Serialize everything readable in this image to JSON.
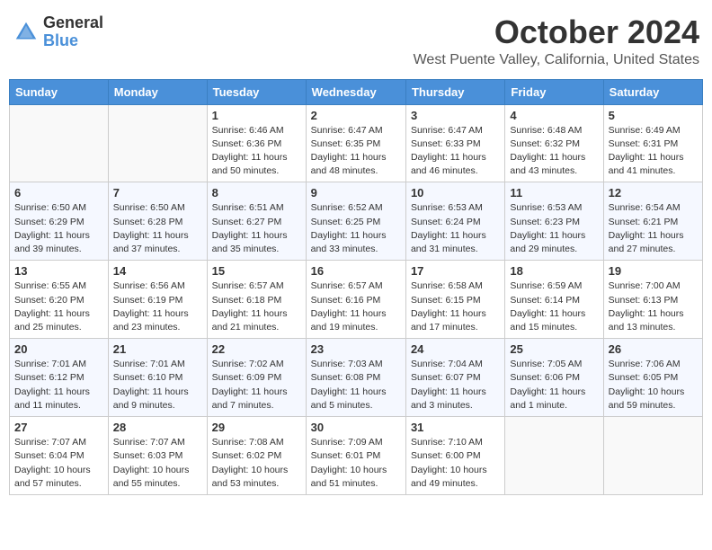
{
  "header": {
    "logo_general": "General",
    "logo_blue": "Blue",
    "month_title": "October 2024",
    "subtitle": "West Puente Valley, California, United States"
  },
  "days_of_week": [
    "Sunday",
    "Monday",
    "Tuesday",
    "Wednesday",
    "Thursday",
    "Friday",
    "Saturday"
  ],
  "weeks": [
    [
      {
        "day": "",
        "info": ""
      },
      {
        "day": "",
        "info": ""
      },
      {
        "day": "1",
        "info": "Sunrise: 6:46 AM\nSunset: 6:36 PM\nDaylight: 11 hours and 50 minutes."
      },
      {
        "day": "2",
        "info": "Sunrise: 6:47 AM\nSunset: 6:35 PM\nDaylight: 11 hours and 48 minutes."
      },
      {
        "day": "3",
        "info": "Sunrise: 6:47 AM\nSunset: 6:33 PM\nDaylight: 11 hours and 46 minutes."
      },
      {
        "day": "4",
        "info": "Sunrise: 6:48 AM\nSunset: 6:32 PM\nDaylight: 11 hours and 43 minutes."
      },
      {
        "day": "5",
        "info": "Sunrise: 6:49 AM\nSunset: 6:31 PM\nDaylight: 11 hours and 41 minutes."
      }
    ],
    [
      {
        "day": "6",
        "info": "Sunrise: 6:50 AM\nSunset: 6:29 PM\nDaylight: 11 hours and 39 minutes."
      },
      {
        "day": "7",
        "info": "Sunrise: 6:50 AM\nSunset: 6:28 PM\nDaylight: 11 hours and 37 minutes."
      },
      {
        "day": "8",
        "info": "Sunrise: 6:51 AM\nSunset: 6:27 PM\nDaylight: 11 hours and 35 minutes."
      },
      {
        "day": "9",
        "info": "Sunrise: 6:52 AM\nSunset: 6:25 PM\nDaylight: 11 hours and 33 minutes."
      },
      {
        "day": "10",
        "info": "Sunrise: 6:53 AM\nSunset: 6:24 PM\nDaylight: 11 hours and 31 minutes."
      },
      {
        "day": "11",
        "info": "Sunrise: 6:53 AM\nSunset: 6:23 PM\nDaylight: 11 hours and 29 minutes."
      },
      {
        "day": "12",
        "info": "Sunrise: 6:54 AM\nSunset: 6:21 PM\nDaylight: 11 hours and 27 minutes."
      }
    ],
    [
      {
        "day": "13",
        "info": "Sunrise: 6:55 AM\nSunset: 6:20 PM\nDaylight: 11 hours and 25 minutes."
      },
      {
        "day": "14",
        "info": "Sunrise: 6:56 AM\nSunset: 6:19 PM\nDaylight: 11 hours and 23 minutes."
      },
      {
        "day": "15",
        "info": "Sunrise: 6:57 AM\nSunset: 6:18 PM\nDaylight: 11 hours and 21 minutes."
      },
      {
        "day": "16",
        "info": "Sunrise: 6:57 AM\nSunset: 6:16 PM\nDaylight: 11 hours and 19 minutes."
      },
      {
        "day": "17",
        "info": "Sunrise: 6:58 AM\nSunset: 6:15 PM\nDaylight: 11 hours and 17 minutes."
      },
      {
        "day": "18",
        "info": "Sunrise: 6:59 AM\nSunset: 6:14 PM\nDaylight: 11 hours and 15 minutes."
      },
      {
        "day": "19",
        "info": "Sunrise: 7:00 AM\nSunset: 6:13 PM\nDaylight: 11 hours and 13 minutes."
      }
    ],
    [
      {
        "day": "20",
        "info": "Sunrise: 7:01 AM\nSunset: 6:12 PM\nDaylight: 11 hours and 11 minutes."
      },
      {
        "day": "21",
        "info": "Sunrise: 7:01 AM\nSunset: 6:10 PM\nDaylight: 11 hours and 9 minutes."
      },
      {
        "day": "22",
        "info": "Sunrise: 7:02 AM\nSunset: 6:09 PM\nDaylight: 11 hours and 7 minutes."
      },
      {
        "day": "23",
        "info": "Sunrise: 7:03 AM\nSunset: 6:08 PM\nDaylight: 11 hours and 5 minutes."
      },
      {
        "day": "24",
        "info": "Sunrise: 7:04 AM\nSunset: 6:07 PM\nDaylight: 11 hours and 3 minutes."
      },
      {
        "day": "25",
        "info": "Sunrise: 7:05 AM\nSunset: 6:06 PM\nDaylight: 11 hours and 1 minute."
      },
      {
        "day": "26",
        "info": "Sunrise: 7:06 AM\nSunset: 6:05 PM\nDaylight: 10 hours and 59 minutes."
      }
    ],
    [
      {
        "day": "27",
        "info": "Sunrise: 7:07 AM\nSunset: 6:04 PM\nDaylight: 10 hours and 57 minutes."
      },
      {
        "day": "28",
        "info": "Sunrise: 7:07 AM\nSunset: 6:03 PM\nDaylight: 10 hours and 55 minutes."
      },
      {
        "day": "29",
        "info": "Sunrise: 7:08 AM\nSunset: 6:02 PM\nDaylight: 10 hours and 53 minutes."
      },
      {
        "day": "30",
        "info": "Sunrise: 7:09 AM\nSunset: 6:01 PM\nDaylight: 10 hours and 51 minutes."
      },
      {
        "day": "31",
        "info": "Sunrise: 7:10 AM\nSunset: 6:00 PM\nDaylight: 10 hours and 49 minutes."
      },
      {
        "day": "",
        "info": ""
      },
      {
        "day": "",
        "info": ""
      }
    ]
  ]
}
